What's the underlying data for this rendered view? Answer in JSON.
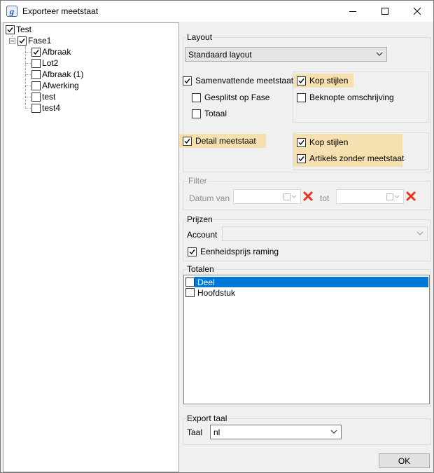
{
  "window": {
    "title": "Exporteer meetstaat",
    "controls": {
      "minimize": "—",
      "maximize": "☐",
      "close": "✕"
    }
  },
  "tree": {
    "root": {
      "label": "Test",
      "checked": true
    },
    "phase": {
      "label": "Fase1",
      "checked": true
    },
    "items": [
      {
        "label": "Afbraak",
        "checked": true
      },
      {
        "label": "Lot2",
        "checked": false
      },
      {
        "label": "Afbraak (1)",
        "checked": false
      },
      {
        "label": "Afwerking",
        "checked": false
      },
      {
        "label": "test",
        "checked": false
      },
      {
        "label": "test4",
        "checked": false
      }
    ]
  },
  "layout": {
    "group_title": "Layout",
    "selected": "Standaard layout",
    "samenvattende": "Samenvattende meetstaat",
    "gesplitst": "Gesplitst op Fase",
    "totaal": "Totaal",
    "kop_stijlen_1": "Kop stijlen",
    "beknopte": "Beknopte omschrijving",
    "detail": "Detail meetstaat",
    "kop_stijlen_2": "Kop stijlen",
    "artikels": "Artikels zonder meetstaat"
  },
  "filter": {
    "group_title": "Filter",
    "datum_van": "Datum van",
    "tot": "tot"
  },
  "prijzen": {
    "group_title": "Prijzen",
    "account_label": "Account",
    "account_value": "",
    "eenheidsprijs": "Eenheidsprijs raming"
  },
  "totalen": {
    "group_title": "Totalen",
    "items": [
      {
        "label": "Deel",
        "checked": false,
        "selected": true
      },
      {
        "label": "Hoofdstuk",
        "checked": false,
        "selected": false
      }
    ]
  },
  "export": {
    "group_title": "Export taal",
    "taal_label": "Taal",
    "taal_value": "nl"
  },
  "ok_label": "OK",
  "colors": {
    "highlight": "#f6e0b0",
    "selection": "#0078d7",
    "delete": "#e8331c"
  }
}
